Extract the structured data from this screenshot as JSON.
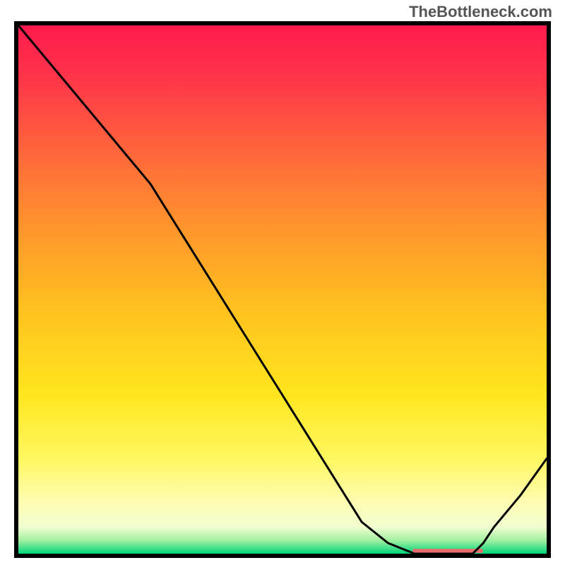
{
  "watermark": "TheBottleneck.com",
  "chart_data": {
    "type": "line",
    "x": [
      0,
      5,
      10,
      15,
      20,
      25,
      30,
      35,
      40,
      45,
      50,
      55,
      60,
      65,
      70,
      75,
      80,
      82,
      84,
      86,
      88,
      90,
      95,
      100
    ],
    "values": [
      100,
      94,
      88,
      82,
      76,
      70,
      62,
      54,
      46,
      38,
      30,
      22,
      14,
      6,
      2,
      0,
      0,
      0,
      0,
      0,
      2,
      5,
      11,
      18
    ],
    "xlim": [
      0,
      100
    ],
    "ylim": [
      0,
      100
    ],
    "xlabel": "",
    "ylabel": "",
    "title": "",
    "grid": false,
    "background": {
      "type": "vertical-gradient",
      "stops": [
        {
          "pos": 0.0,
          "color": "#ff1a4d"
        },
        {
          "pos": 0.1,
          "color": "#ff3549"
        },
        {
          "pos": 0.25,
          "color": "#ff6a3a"
        },
        {
          "pos": 0.4,
          "color": "#ff9a2a"
        },
        {
          "pos": 0.55,
          "color": "#ffc41e"
        },
        {
          "pos": 0.7,
          "color": "#ffe61e"
        },
        {
          "pos": 0.82,
          "color": "#fff760"
        },
        {
          "pos": 0.9,
          "color": "#fffdb0"
        },
        {
          "pos": 0.95,
          "color": "#f0ffd0"
        },
        {
          "pos": 0.975,
          "color": "#a0f0a0"
        },
        {
          "pos": 1.0,
          "color": "#00d47a"
        }
      ]
    },
    "axis_border_color": "#000000",
    "line_color": "#000000",
    "highlight": {
      "x_start": 75,
      "x_end": 88,
      "y": 0,
      "color": "#e86a6a",
      "thickness": 6
    }
  }
}
